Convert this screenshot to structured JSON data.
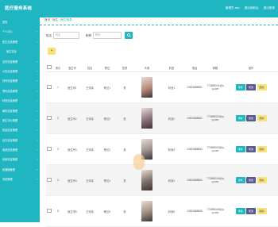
{
  "topbar": {
    "brand": "医疗服务系统",
    "user": "管理员 abo",
    "home": "退出到前台",
    "logout": "退出登录"
  },
  "sidebar": {
    "items": [
      {
        "label": "首页",
        "sub": false
      },
      {
        "label": "个人中心",
        "sub": false
      },
      {
        "label": "医生信息管理",
        "sub": false
      },
      {
        "label": "医生信息",
        "sub": true
      },
      {
        "label": "会员信息管理",
        "sub": false
      },
      {
        "label": "公告信息管理",
        "sub": false
      },
      {
        "label": "挂号信息管理",
        "sub": false
      },
      {
        "label": "预约信息管理",
        "sub": false
      },
      {
        "label": "科室信息管理",
        "sub": false
      },
      {
        "label": "病历信息管理",
        "sub": false
      },
      {
        "label": "医生评价管理",
        "sub": false
      },
      {
        "label": "药品信息管理",
        "sub": false
      },
      {
        "label": "处方信息管理",
        "sub": false
      },
      {
        "label": "收费信息管理",
        "sub": false
      },
      {
        "label": "系统信息管理",
        "sub": false
      },
      {
        "label": "轮播图管理",
        "sub": false
      },
      {
        "label": "系统管理",
        "sub": false
      }
    ]
  },
  "breadcrumb": {
    "home": "首页",
    "section": "医生",
    "current": "医生信息"
  },
  "filter": {
    "label1": "姓名",
    "placeholder1": "姓名",
    "label2": "职称",
    "placeholder2": "职称"
  },
  "add_button": "+",
  "table": {
    "headers": [
      "",
      "索引",
      "医生号",
      "姓名",
      "职位",
      "性别",
      "头像",
      "科室",
      "电话",
      "邮箱",
      "操作"
    ],
    "rows": [
      {
        "index": "1",
        "doctor_no": "医生号1",
        "name": "王伟伟",
        "title": "职位1",
        "gender": "男",
        "dept": "科室1",
        "phone": "13823888881",
        "email": "773890001@qq.com",
        "photo_color": "#b88a78"
      },
      {
        "index": "2",
        "doctor_no": "医生号2",
        "name": "王伟伟",
        "title": "职位2",
        "gender": "男",
        "dept": "科室2",
        "phone": "13823888882",
        "email": "773890002@qq.com",
        "photo_color": "#8a6f7a"
      },
      {
        "index": "3",
        "doctor_no": "医生号3",
        "name": "王伟伟",
        "title": "职位3",
        "gender": "男",
        "dept": "科室3",
        "phone": "13823888883",
        "email": "773890003@qq.com",
        "photo_color": "#9a8f8a"
      },
      {
        "index": "4",
        "doctor_no": "医生号4",
        "name": "王伟伟",
        "title": "职位4",
        "gender": "男",
        "dept": "科室4",
        "phone": "13823888884",
        "email": "773890004@qq.com",
        "photo_color": "#7d6f66"
      },
      {
        "index": "5",
        "doctor_no": "医生号5",
        "name": "王伟伟",
        "title": "职位5",
        "gender": "男",
        "dept": "科室5",
        "phone": "13823888885",
        "email": "773890005@qq.com",
        "photo_color": "#a08d80"
      }
    ],
    "ops": {
      "detail": "详情",
      "edit": "修改",
      "delete": "删除"
    }
  },
  "colors": {
    "accent": "#20b6c1",
    "edit": "#5b5b8f",
    "delete": "#f7e37a"
  }
}
